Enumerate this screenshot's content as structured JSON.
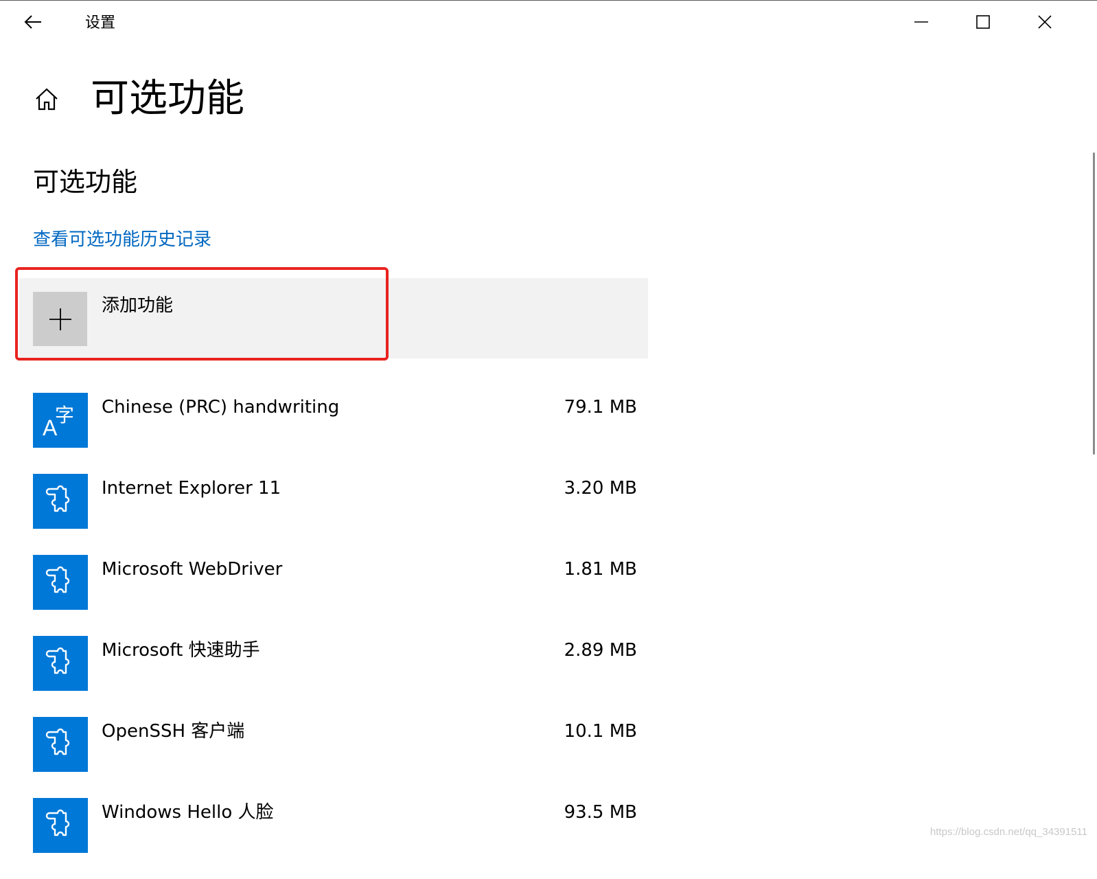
{
  "window": {
    "title": "设置",
    "controls": [
      "minimize-icon",
      "maximize-icon",
      "close-icon"
    ]
  },
  "page": {
    "title": "可选功能",
    "section_title": "可选功能",
    "history_link": "查看可选功能历史记录",
    "add_feature_label": "添加功能"
  },
  "features": [
    {
      "name": "Chinese (PRC) handwriting",
      "size": "79.1 MB",
      "icon": "language-icon"
    },
    {
      "name": "Internet Explorer 11",
      "size": "3.20 MB",
      "icon": "puzzle-icon"
    },
    {
      "name": "Microsoft WebDriver",
      "size": "1.81 MB",
      "icon": "puzzle-icon"
    },
    {
      "name": "Microsoft 快速助手",
      "size": "2.89 MB",
      "icon": "puzzle-icon"
    },
    {
      "name": "OpenSSH 客户端",
      "size": "10.1 MB",
      "icon": "puzzle-icon"
    },
    {
      "name": "Windows Hello 人脸",
      "size": "93.5 MB",
      "icon": "puzzle-icon"
    }
  ],
  "language_icon_glyphs": {
    "latin": "A",
    "cjk": "字"
  },
  "watermark": "https://blog.csdn.net/qq_34391511",
  "colors": {
    "accent": "#0078d7",
    "link": "#0067c0",
    "highlight": "#e8231f",
    "add_bg": "#f2f2f2"
  }
}
